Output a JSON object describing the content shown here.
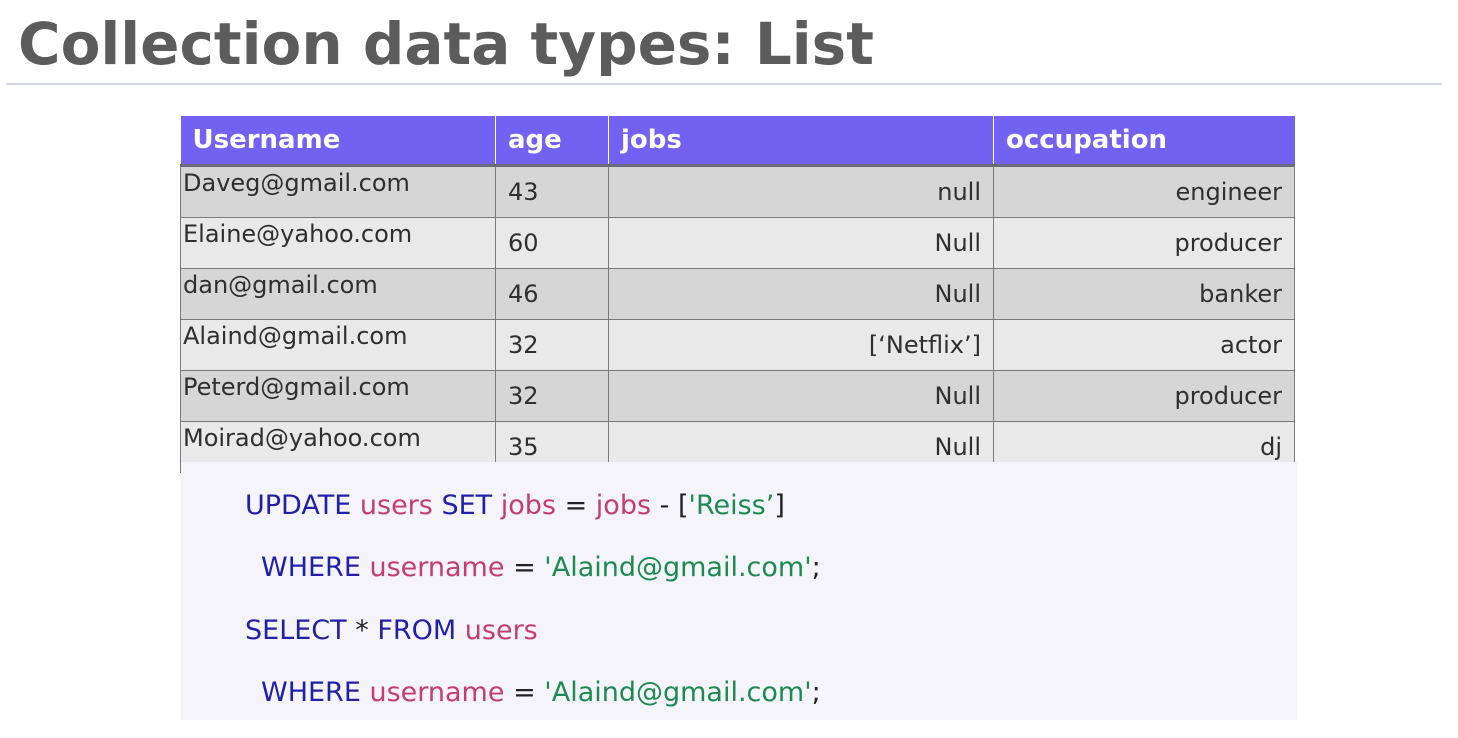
{
  "slide": {
    "title": "Collection data types: List"
  },
  "table": {
    "headers": [
      "Username",
      "age",
      "jobs",
      "occupation"
    ],
    "rows": [
      {
        "username": "Daveg@gmail.com",
        "age": "43",
        "jobs": "null",
        "occupation": "engineer"
      },
      {
        "username": "Elaine@yahoo.com",
        "age": "60",
        "jobs": "Null",
        "occupation": "producer"
      },
      {
        "username": "dan@gmail.com",
        "age": "46",
        "jobs": "Null",
        "occupation": "banker"
      },
      {
        "username": "Alaind@gmail.com",
        "age": "32",
        "jobs": "[‘Netflix’]",
        "occupation": "actor"
      },
      {
        "username": "Peterd@gmail.com",
        "age": "32",
        "jobs": "Null",
        "occupation": "producer"
      },
      {
        "username": "Moirad@yahoo.com",
        "age": "35",
        "jobs": "Null",
        "occupation": "dj"
      }
    ]
  },
  "code": {
    "line1": {
      "kw_update": "UPDATE",
      "tbl": "users",
      "kw_set": "SET",
      "col_lhs": "jobs",
      "eq": "=",
      "col_rhs": "jobs",
      "minus": "-",
      "open_br": "[",
      "str_val": "'Reiss’",
      "close_br": "]"
    },
    "line2": {
      "kw_where": "WHERE",
      "col": "username",
      "eq": "=",
      "str_val": "'Alaind@gmail.com'",
      "semi": ";"
    },
    "line3": {
      "kw_select": "SELECT",
      "star": "*",
      "kw_from": "FROM",
      "tbl": "users"
    },
    "line4": {
      "kw_where": "WHERE",
      "col": "username",
      "eq": "=",
      "str_val": "'Alaind@gmail.com'",
      "semi": ";"
    }
  },
  "colors": {
    "header_bg": "#7361f2",
    "keyword": "#1f1fa8",
    "identifier": "#c43c74",
    "string": "#1e8a52"
  }
}
